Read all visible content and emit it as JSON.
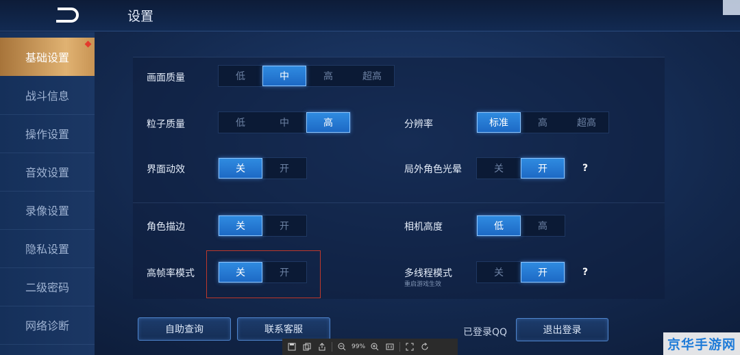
{
  "header": {
    "title": "设置"
  },
  "sidebar": {
    "items": [
      {
        "label": "基础设置",
        "active": true
      },
      {
        "label": "战斗信息"
      },
      {
        "label": "操作设置"
      },
      {
        "label": "音效设置"
      },
      {
        "label": "录像设置"
      },
      {
        "label": "隐私设置"
      },
      {
        "label": "二级密码"
      },
      {
        "label": "网络诊断"
      }
    ]
  },
  "settings": {
    "picture_quality": {
      "label": "画面质量",
      "options": [
        "低",
        "中",
        "高",
        "超高"
      ],
      "selected": "中"
    },
    "particle_quality": {
      "label": "粒子质量",
      "options": [
        "低",
        "中",
        "高"
      ],
      "selected": "高"
    },
    "resolution": {
      "label": "分辨率",
      "options": [
        "标准",
        "高",
        "超高"
      ],
      "selected": "标准"
    },
    "ui_animation": {
      "label": "界面动效",
      "options": [
        "关",
        "开"
      ],
      "selected": "关"
    },
    "outfield_glow": {
      "label": "局外角色光晕",
      "options": [
        "关",
        "开"
      ],
      "selected": "开"
    },
    "outline": {
      "label": "角色描边",
      "options": [
        "关",
        "开"
      ],
      "selected": "关"
    },
    "camera_height": {
      "label": "相机高度",
      "options": [
        "低",
        "高"
      ],
      "selected": "低"
    },
    "high_fps": {
      "label": "高帧率模式",
      "options": [
        "关",
        "开"
      ],
      "selected": "关"
    },
    "multithread": {
      "label": "多线程模式",
      "sublabel": "重启游戏生效",
      "options": [
        "关",
        "开"
      ],
      "selected": "开"
    }
  },
  "footer": {
    "self_query": "自助查询",
    "contact_service": "联系客服",
    "login_status": "已登录QQ",
    "logout": "退出登录"
  },
  "viewer": {
    "zoom": "99%"
  },
  "watermark": "京华手游网",
  "colors": {
    "accent": "#2f8be0",
    "active_tab": "#e0b272",
    "highlight": "#c0392b"
  }
}
